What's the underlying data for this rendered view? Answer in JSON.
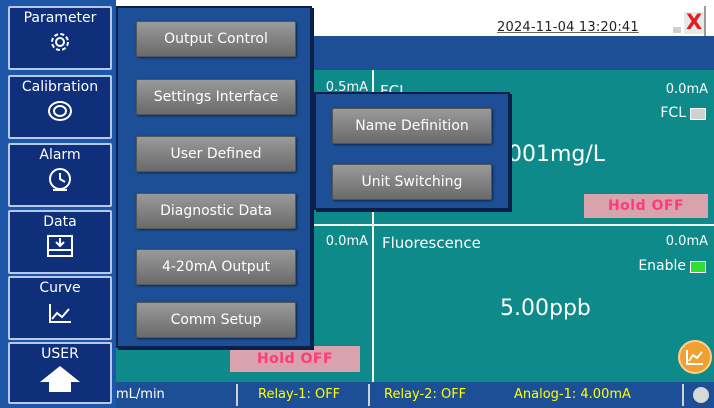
{
  "header": {
    "datetime": "2024-11-04 13:20:41",
    "close_label": "X"
  },
  "sidebar": {
    "items": [
      {
        "label": "Parameter",
        "icon": "gear-icon"
      },
      {
        "label": "Calibration",
        "icon": "target-icon"
      },
      {
        "label": "Alarm",
        "icon": "clock-alarm-icon"
      },
      {
        "label": "Data",
        "icon": "disk-icon"
      },
      {
        "label": "Curve",
        "icon": "trend-icon"
      },
      {
        "label": "USER",
        "icon": "home-icon"
      }
    ]
  },
  "menu": {
    "items": [
      "Output Control",
      "Settings Interface",
      "User Defined",
      "Diagnostic Data",
      "4-20mA Output",
      "Comm Setup"
    ]
  },
  "submenu": {
    "items": [
      "Name Definition",
      "Unit Switching"
    ]
  },
  "panels": {
    "left_top": {
      "current_partial": "0.5mA"
    },
    "fcl": {
      "label": "FCL",
      "current": "0.0mA",
      "toggle_label": "FCL",
      "value_partial": "001mg/L",
      "hold": "Hold OFF",
      "toggle_color": "#d0d0d0"
    },
    "left_bottom": {
      "current_partial": "0.0mA",
      "hold": "Hold OFF"
    },
    "fluorescence": {
      "label": "Fluorescence",
      "current": "0.0mA",
      "toggle_label": "Enable",
      "value": "5.00ppb",
      "toggle_color": "#33dd33"
    }
  },
  "status": {
    "flow": "mL/min",
    "relay1": "Relay-1: OFF",
    "relay2": "Relay-2: OFF",
    "analog1": "Analog-1: 4.00mA"
  },
  "colors": {
    "sidebar": "#1f57a8",
    "panel": "#0e8a8a",
    "statusbar": "#1c4f96",
    "hold_text": "#ff3b7a",
    "status_text": "#ffff00"
  }
}
